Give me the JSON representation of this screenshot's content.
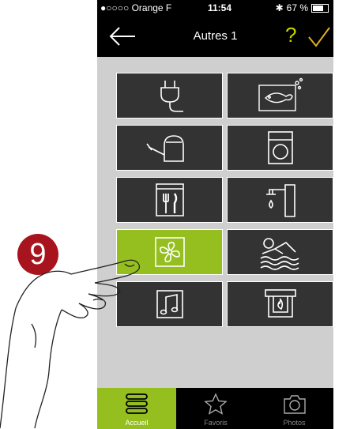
{
  "status_bar": {
    "carrier": "●○○○○ Orange F",
    "time": "11:54",
    "battery_pct": "67 %"
  },
  "nav": {
    "title": "Autres 1",
    "help_label": "?"
  },
  "tiles": [
    {
      "icon": "plug-icon",
      "active": false
    },
    {
      "icon": "aquarium-icon",
      "active": false
    },
    {
      "icon": "watering-can-icon",
      "active": false
    },
    {
      "icon": "washing-machine-icon",
      "active": false
    },
    {
      "icon": "cutlery-icon",
      "active": false
    },
    {
      "icon": "faucet-icon",
      "active": false
    },
    {
      "icon": "fan-icon",
      "active": true
    },
    {
      "icon": "swimming-icon",
      "active": false
    },
    {
      "icon": "music-icon",
      "active": false
    },
    {
      "icon": "fireplace-icon",
      "active": false
    }
  ],
  "tabbar": {
    "tabs": [
      {
        "label": "Accueil",
        "icon": "list-icon",
        "active": true
      },
      {
        "label": "Favoris",
        "icon": "star-icon",
        "active": false
      },
      {
        "label": "Photos",
        "icon": "camera-icon",
        "active": false
      }
    ]
  },
  "step_badge": "9",
  "colors": {
    "accent": "#95bf1f",
    "tile": "#333333",
    "badge": "#a8141e",
    "help": "#c9d400"
  }
}
